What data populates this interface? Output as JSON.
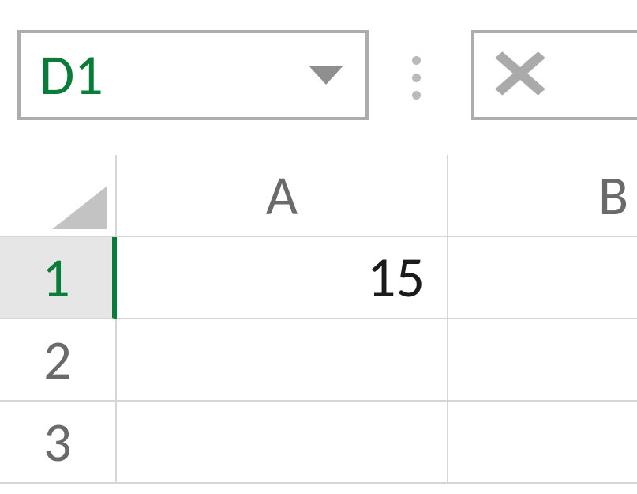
{
  "nameBox": {
    "ref": "D1"
  },
  "columns": [
    "A",
    "B"
  ],
  "rows": [
    "1",
    "2",
    "3"
  ],
  "activeRow": 0,
  "cells": {
    "A1": "15",
    "B1": "",
    "A2": "",
    "B2": "",
    "A3": "",
    "B3": ""
  }
}
